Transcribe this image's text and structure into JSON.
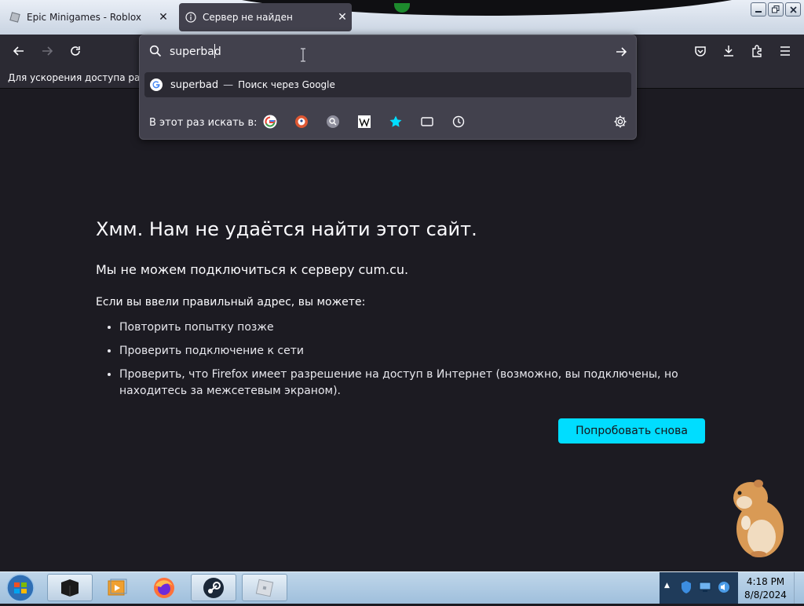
{
  "tabs": [
    {
      "title": "Epic Minigames - Roblox",
      "close": "✕"
    },
    {
      "title": "Сервер не найден",
      "close": "✕"
    }
  ],
  "bookmarks": {
    "hint": "Для ускорения доступа разместите свои закладки на этой панели"
  },
  "urlbar": {
    "value": "superbad"
  },
  "suggestion": {
    "term": "superbad",
    "dash": "—",
    "hint": "Поиск через Google"
  },
  "oneoff": {
    "label": "В этот раз искать в:"
  },
  "error": {
    "title": "Хмм. Нам не удаётся найти этот сайт.",
    "short": "Мы не можем подключиться к серверу cum.cu.",
    "intro": "Если вы ввели правильный адрес, вы можете:",
    "items": [
      "Повторить попытку позже",
      "Проверить подключение к сети",
      "Проверить, что Firefox имеет разрешение на доступ в Интернет (возможно, вы подключены, но находитесь за межсетевым экраном)."
    ],
    "retry_label": "Попробовать снова"
  },
  "taskbar": {
    "time": "4:18 PM",
    "date": "8/8/2024",
    "tray_arrow": "▲"
  },
  "colors": {
    "accent": "#00ddff",
    "page_bg": "#1c1b22",
    "toolbar": "#2b2a33",
    "popup": "#42414d"
  }
}
